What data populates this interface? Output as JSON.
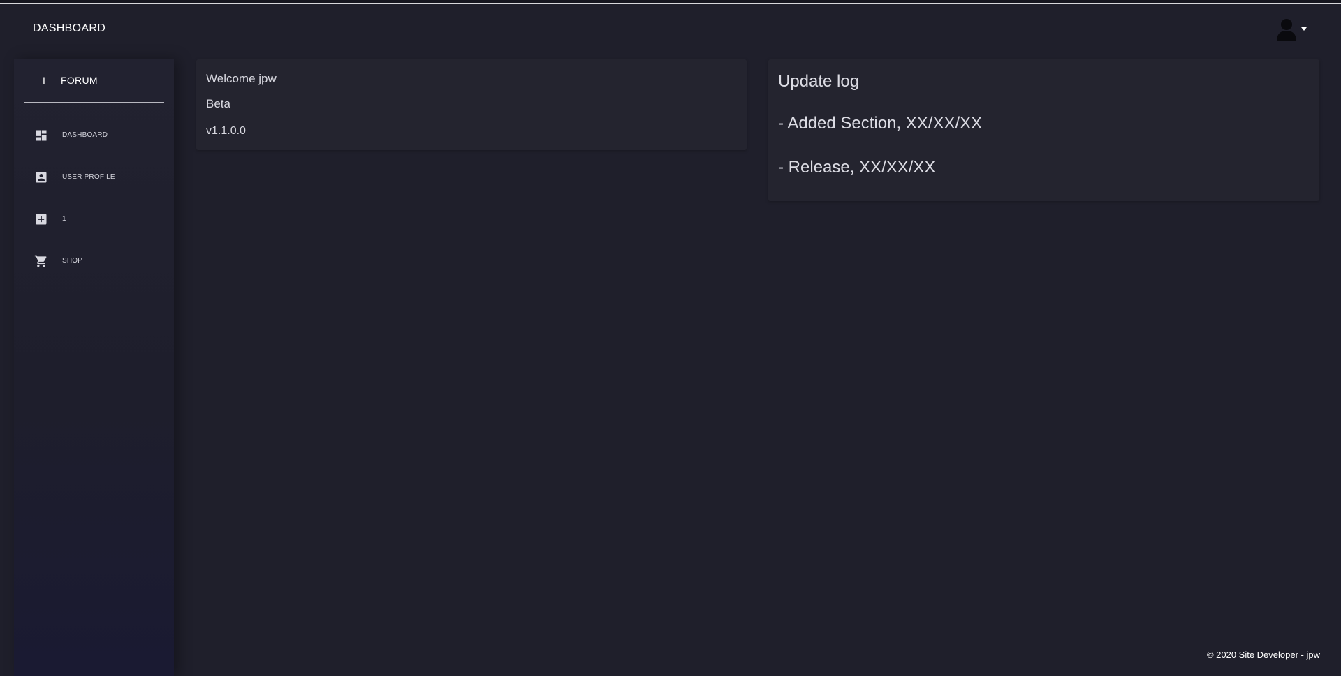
{
  "navbar": {
    "brand": "DASHBOARD",
    "user_icon": "user-avatar-icon",
    "dropdown_icon": "caret-down-icon"
  },
  "sidebar": {
    "logo_mini": "I",
    "logo_text": "FORUM",
    "items": [
      {
        "label": "DASHBOARD",
        "icon": "dashboard-icon"
      },
      {
        "label": "USER PROFILE",
        "icon": "user-profile-icon"
      },
      {
        "label": "1",
        "icon": "plus-box-icon"
      },
      {
        "label": "SHOP",
        "icon": "shopping-cart-icon"
      }
    ]
  },
  "welcome_card": {
    "greeting": "Welcome jpw",
    "status": "Beta",
    "version": "v1.1.0.0"
  },
  "update_log": {
    "title": "Update log",
    "entries": [
      "- Added Section, XX/XX/XX",
      "- Release, XX/XX/XX"
    ]
  },
  "footer": {
    "text": "© 2020 Site Developer - jpw"
  },
  "colors": {
    "background": "#1f1f2b",
    "sidebar": "#222230",
    "card": "#24242f",
    "text": "#e6e6ec"
  }
}
